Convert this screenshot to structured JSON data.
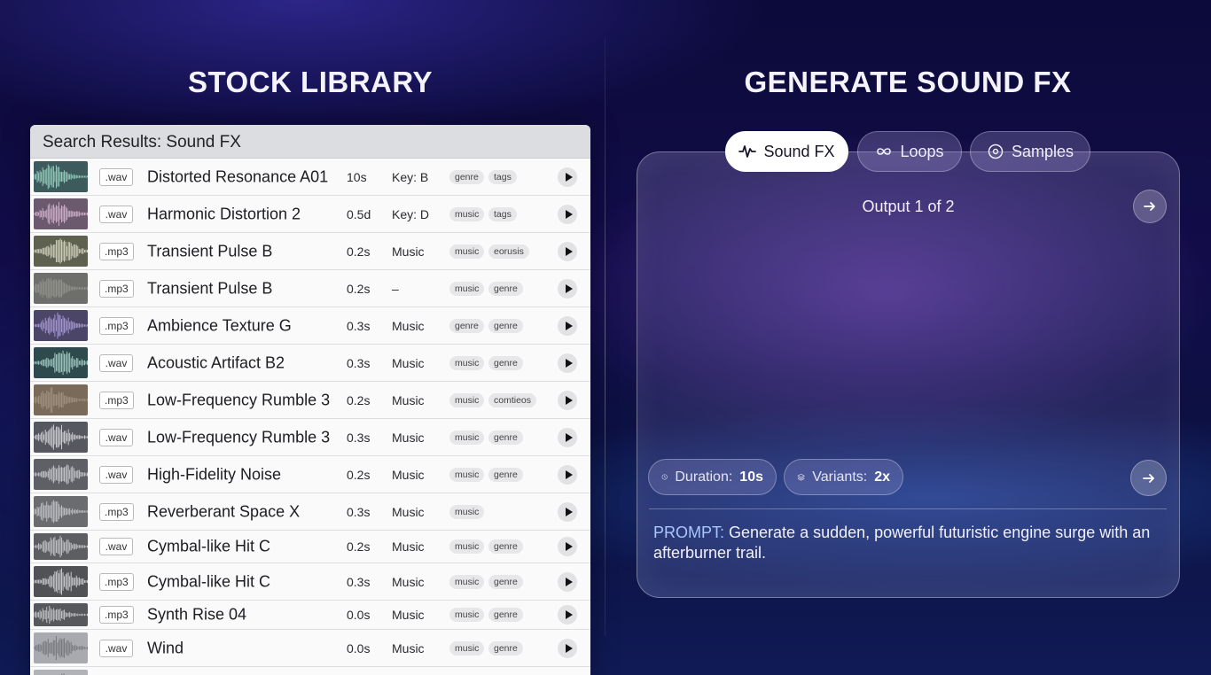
{
  "stock_library": {
    "title": "STOCK LIBRARY",
    "header": "Search Results: Sound FX",
    "rows": [
      {
        "ext": ".wav",
        "name": "Distorted Resonance A01",
        "duration": "10s",
        "meta": "Key: B",
        "tags": [
          "genre",
          "tags"
        ],
        "thumb_color": "#3d5a5c",
        "wave_color": "#a6e3d0"
      },
      {
        "ext": ".wav",
        "name": "Harmonic Distortion 2",
        "duration": "0.5d",
        "meta": "Key: D",
        "tags": [
          "music",
          "tags"
        ],
        "thumb_color": "#6b5a6e",
        "wave_color": "#e2c2dc"
      },
      {
        "ext": ".mp3",
        "name": "Transient Pulse B",
        "duration": "0.2s",
        "meta": "Music",
        "tags": [
          "music",
          "eorusis"
        ],
        "thumb_color": "#5e6050",
        "wave_color": "#e6e8d2"
      },
      {
        "ext": ".mp3",
        "name": "Transient Pulse B",
        "duration": "0.2s",
        "meta": "–",
        "tags": [
          "music",
          "genre"
        ],
        "thumb_color": "#6e6e6a",
        "wave_color": "#9a9a94"
      },
      {
        "ext": ".mp3",
        "name": "Ambience Texture G",
        "duration": "0.3s",
        "meta": "Music",
        "tags": [
          "genre",
          "genre"
        ],
        "thumb_color": "#4b4668",
        "wave_color": "#b8a8e6"
      },
      {
        "ext": ".wav",
        "name": "Acoustic Artifact B2",
        "duration": "0.3s",
        "meta": "Music",
        "tags": [
          "music",
          "genre"
        ],
        "thumb_color": "#2f4a4c",
        "wave_color": "#b6e2d8"
      },
      {
        "ext": ".mp3",
        "name": "Low-Frequency Rumble 3",
        "duration": "0.2s",
        "meta": "Music",
        "tags": [
          "music",
          "comtieos"
        ],
        "thumb_color": "#7a6a5a",
        "wave_color": "#a89888"
      },
      {
        "ext": ".wav",
        "name": "Low-Frequency Rumble 3",
        "duration": "0.3s",
        "meta": "Music",
        "tags": [
          "music",
          "genre"
        ],
        "thumb_color": "#55585e",
        "wave_color": "#e4e6ea"
      },
      {
        "ext": ".wav",
        "name": "High-Fidelity Noise",
        "duration": "0.2s",
        "meta": "Music",
        "tags": [
          "music",
          "genre"
        ],
        "thumb_color": "#5e6066",
        "wave_color": "#d8dadf"
      },
      {
        "ext": ".mp3",
        "name": "Reverberant Space X",
        "duration": "0.3s",
        "meta": "Music",
        "tags": [
          "music"
        ],
        "thumb_color": "#6a6c70",
        "wave_color": "#cfd1d6"
      },
      {
        "ext": ".wav",
        "name": "Cymbal-like Hit C",
        "duration": "0.2s",
        "meta": "Music",
        "tags": [
          "music",
          "genre"
        ],
        "thumb_color": "#5c5e62",
        "wave_color": "#d4d6da"
      },
      {
        "ext": ".mp3",
        "name": "Cymbal-like Hit C",
        "duration": "0.3s",
        "meta": "Music",
        "tags": [
          "music",
          "genre"
        ],
        "thumb_color": "#505256",
        "wave_color": "#e0e2e6"
      },
      {
        "ext": ".mp3",
        "name": "Synth Rise 04",
        "duration": "0.0s",
        "meta": "Music",
        "tags": [
          "music",
          "genre"
        ],
        "thumb_color": "#56585c",
        "wave_color": "#d6d8dc"
      },
      {
        "ext": ".wav",
        "name": "Wind",
        "duration": "0.0s",
        "meta": "Music",
        "tags": [
          "music",
          "genre"
        ],
        "thumb_color": "#a8aab0",
        "wave_color": "#6e7076"
      },
      {
        "ext": "",
        "name": "",
        "duration": "",
        "meta": "",
        "tags": [],
        "thumb_color": "#b0b2b6",
        "wave_color": "#7a7c80"
      }
    ]
  },
  "generate": {
    "title": "GENERATE SOUND FX",
    "tabs": [
      {
        "label": "Sound FX",
        "icon": "pulse-icon",
        "active": true
      },
      {
        "label": "Loops",
        "icon": "infinity-icon",
        "active": false
      },
      {
        "label": "Samples",
        "icon": "disc-icon",
        "active": false
      }
    ],
    "output_label": "Output 1 of 2",
    "duration_label": "Duration:",
    "duration_value": "10s",
    "variants_label": "Variants:",
    "variants_value": "2x",
    "prompt_prefix": "PROMPT:",
    "prompt_text": " Generate a sudden, powerful futuristic engine surge with an afterburner trail.",
    "wave_colors": [
      "#8fe0e0",
      "#c9b8ee",
      "#d6b8f0"
    ]
  }
}
